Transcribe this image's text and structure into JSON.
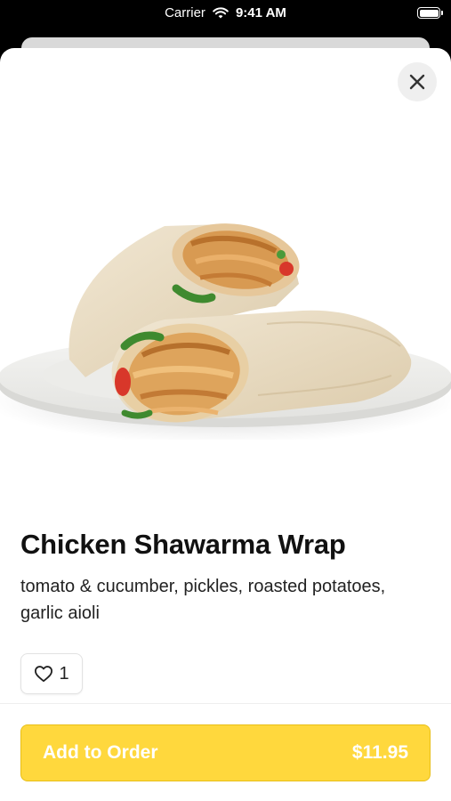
{
  "status_bar": {
    "carrier": "Carrier",
    "time": "9:41 AM"
  },
  "item": {
    "title": "Chicken Shawarma Wrap",
    "description": "tomato & cucumber, pickles, roasted potatoes, garlic aioli",
    "likes": "1",
    "image_alt": "Chicken shawarma wrap cut in half on a white plate"
  },
  "actions": {
    "add_label": "Add to Order",
    "price": "$11.95"
  },
  "icons": {
    "close": "close-icon",
    "like": "heart-outline-icon",
    "wifi": "wifi-icon",
    "battery": "battery-icon"
  },
  "colors": {
    "accent": "#FFD83D",
    "text": "#111111",
    "sheet": "#FFFFFF"
  }
}
